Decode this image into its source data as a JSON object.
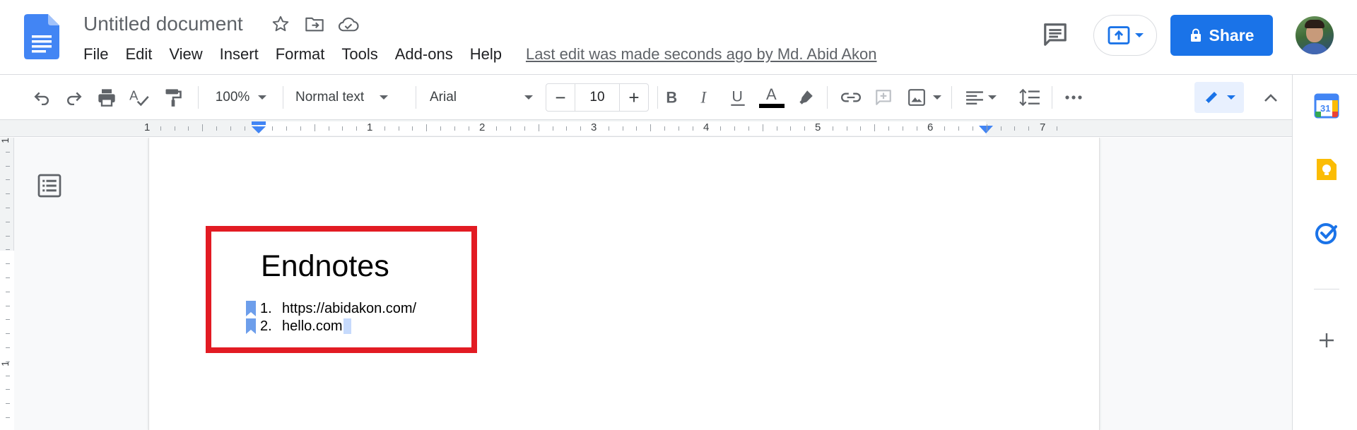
{
  "document": {
    "title": "Untitled document",
    "last_edit": "Last edit was made seconds ago by Md. Abid Akon"
  },
  "menu": [
    "File",
    "Edit",
    "View",
    "Insert",
    "Format",
    "Tools",
    "Add-ons",
    "Help"
  ],
  "header": {
    "share_label": "Share"
  },
  "toolbar": {
    "zoom": "100%",
    "style": "Normal text",
    "font": "Arial",
    "font_size": "10",
    "minus": "−",
    "plus": "+"
  },
  "ruler": {
    "numbers": [
      "1",
      "1",
      "2",
      "3",
      "4",
      "5",
      "6",
      "7"
    ]
  },
  "vertical_ruler": {
    "numbers": [
      "1",
      "1"
    ]
  },
  "content": {
    "heading": "Endnotes",
    "endnotes": [
      {
        "num": "1.",
        "text": "https://abidakon.com/"
      },
      {
        "num": "2.",
        "text": "hello.com"
      }
    ]
  },
  "colors": {
    "accent": "#1a73e8",
    "highlight_border": "#e21b23",
    "bookmark": "#6d9eeb"
  }
}
